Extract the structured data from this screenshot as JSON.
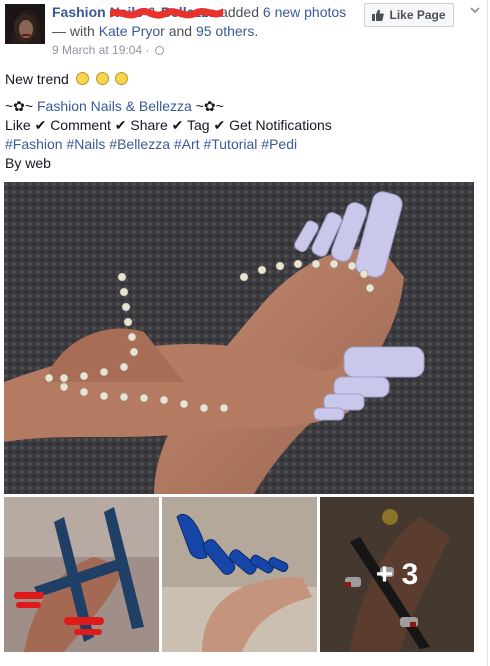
{
  "header": {
    "page_name": "Fashion",
    "redacted_text": "Nails & Bellezza",
    "action_text": " added ",
    "photo_count": "6 new photos",
    "with_text": " — with ",
    "tagged_person": "Kate Pryor",
    "and_text": " and ",
    "others_text": "95 others",
    "period": ".",
    "timestamp": "9 March at 19:04",
    "separator": " · ",
    "like_page_label": "Like Page"
  },
  "post": {
    "line1": "New trend",
    "line2_prefix": "~✿~ ",
    "line2_link": "Fashion Nails & Bellezza",
    "line2_suffix": " ~✿~",
    "line3": "Like ✔ Comment ✔ Share ✔ Tag ✔ Get Notifications",
    "hashtags": [
      "#Fashion",
      "#Nails",
      "#Bellezza",
      "#Art",
      "#Tutorial",
      "#Pedi"
    ],
    "line5": "By web"
  },
  "photos": {
    "more_label": "+ 3"
  },
  "colors": {
    "link": "#3b5998",
    "meta": "#90949c",
    "scribble": "#e8322b"
  },
  "icons": [
    "thumbs-up-icon",
    "chevron-down-icon",
    "globe-icon",
    "emoji-icon"
  ]
}
